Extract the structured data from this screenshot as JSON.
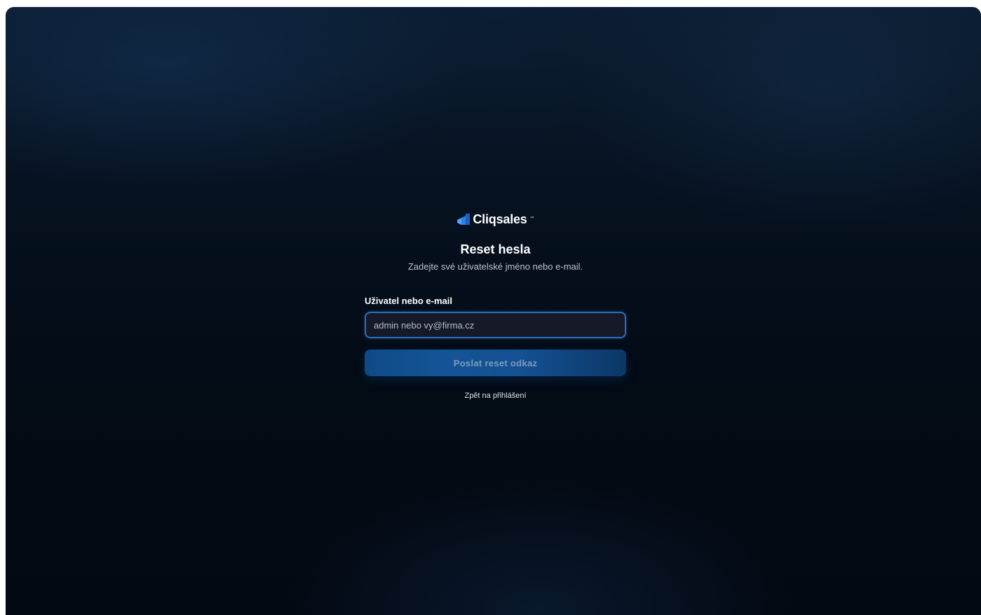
{
  "brand": {
    "name": "Cliqsales",
    "trademark": "™",
    "icon": "cliqsales-logo-icon",
    "accent_color": "#2a7de1"
  },
  "reset": {
    "title": "Reset hesla",
    "subtitle": "Zadejte své uživatelské jméno nebo e-mail.",
    "field_label": "Uživatel nebo e-mail",
    "input_value": "",
    "input_placeholder": "admin nebo vy@firma.cz",
    "submit_label": "Poslat reset odkaz",
    "back_link": "Zpět na přihlášení"
  }
}
